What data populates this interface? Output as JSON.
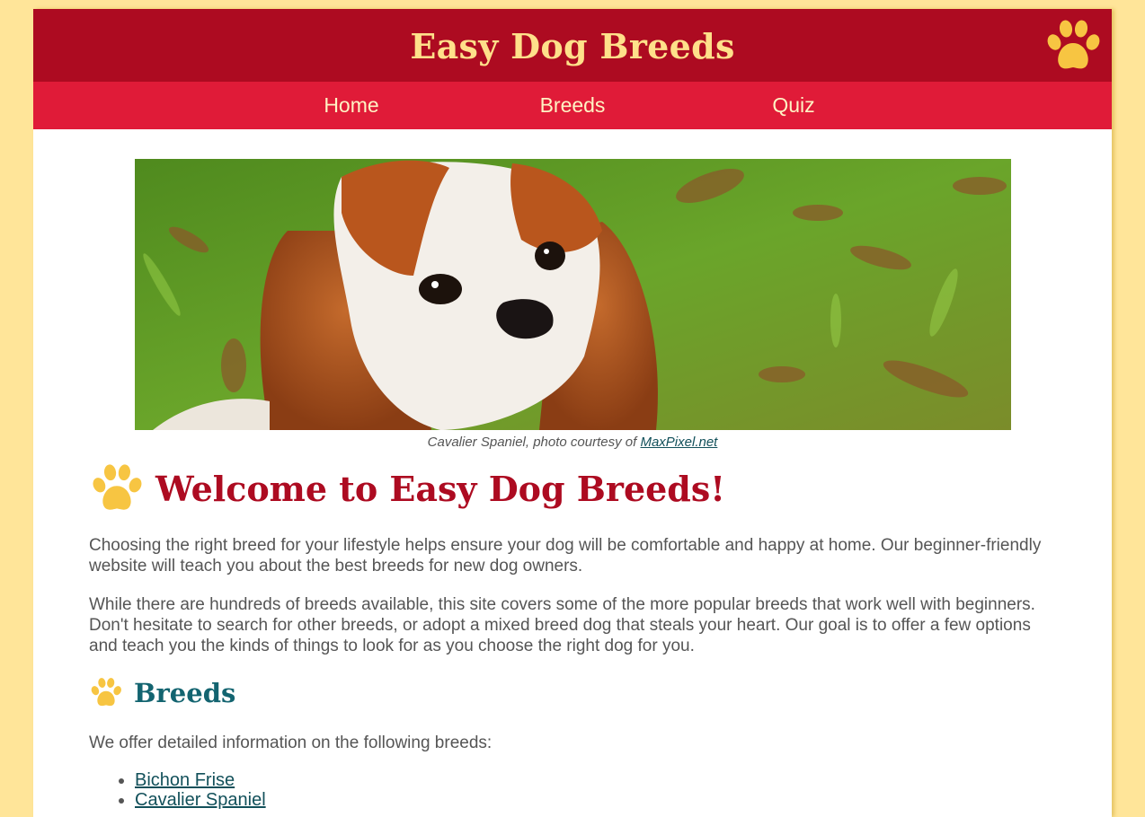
{
  "header": {
    "title": "Easy Dog Breeds"
  },
  "nav": {
    "items": [
      {
        "label": "Home"
      },
      {
        "label": "Breeds"
      },
      {
        "label": "Quiz"
      }
    ]
  },
  "hero": {
    "caption_text": "Cavalier Spaniel, photo courtesy of ",
    "caption_link": "MaxPixel.net"
  },
  "main": {
    "welcome_heading": "Welcome to Easy Dog Breeds!",
    "paragraph1": "Choosing the right breed for your lifestyle helps ensure your dog will be comfortable and happy at home. Our beginner-friendly website will teach you about the best breeds for new dog owners.",
    "paragraph2": "While there are hundreds of breeds available, this site covers some of the more popular breeds that work well with beginners. Don't hesitate to search for other breeds, or adopt a mixed breed dog that steals your heart. Our goal is to offer a few options and teach you the kinds of things to look for as you choose the right dog for you.",
    "breeds_heading": "Breeds",
    "breeds_intro": "We offer detailed information on the following breeds:",
    "breeds": [
      {
        "label": "Bichon Frise"
      },
      {
        "label": "Cavalier Spaniel"
      }
    ]
  },
  "colors": {
    "background": "#ffe599",
    "banner": "#ad0b21",
    "nav": "#e01b38",
    "title_text": "#ffe08a",
    "heading_red": "#ad0b21",
    "heading_teal": "#136470",
    "paw": "#f7c542"
  }
}
